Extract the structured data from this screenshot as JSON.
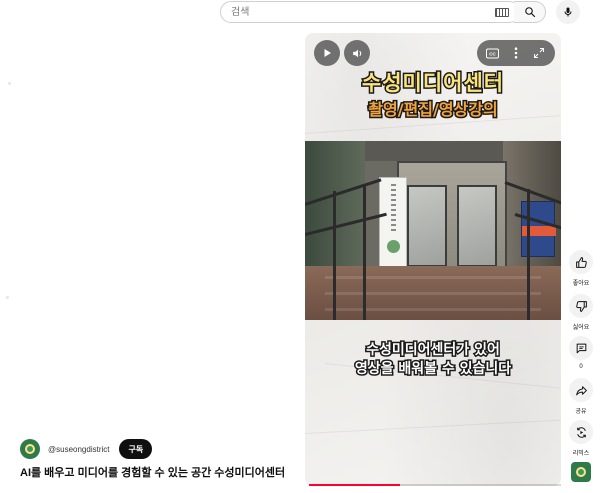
{
  "search": {
    "placeholder": "검색"
  },
  "icons": {
    "keyboard": "keyboard-icon",
    "search": "search-icon",
    "mic": "microphone-icon",
    "play": "play-icon",
    "volume": "volume-icon",
    "captions": "captions-icon",
    "more": "more-vertical-icon",
    "fullscreen": "fullscreen-icon",
    "like": "thumbs-up-icon",
    "dislike": "thumbs-down-icon",
    "comment": "comment-icon",
    "share": "share-icon",
    "remix": "remix-icon"
  },
  "player": {
    "overlay_title": "수성미디어센터",
    "overlay_subtitle": "촬영/편집/영상강의",
    "caption_line1": "수성미디어센터가 있어",
    "caption_line2": "영상을 배워볼 수 있습니다",
    "progress_fraction": 0.36,
    "progress_color": "#ff0033"
  },
  "channel": {
    "handle": "@suseongdistrict",
    "subscribe_label": "구독",
    "avatar_color": "#2f7a4b"
  },
  "video": {
    "title": "AI를 배우고 미디어를 경험할 수 있는 공간 수성미디어센터"
  },
  "actions": {
    "like_label": "좋아요",
    "dislike_label": "싫어요",
    "comment_count": "0",
    "share_label": "공유",
    "remix_label": "리믹스"
  }
}
